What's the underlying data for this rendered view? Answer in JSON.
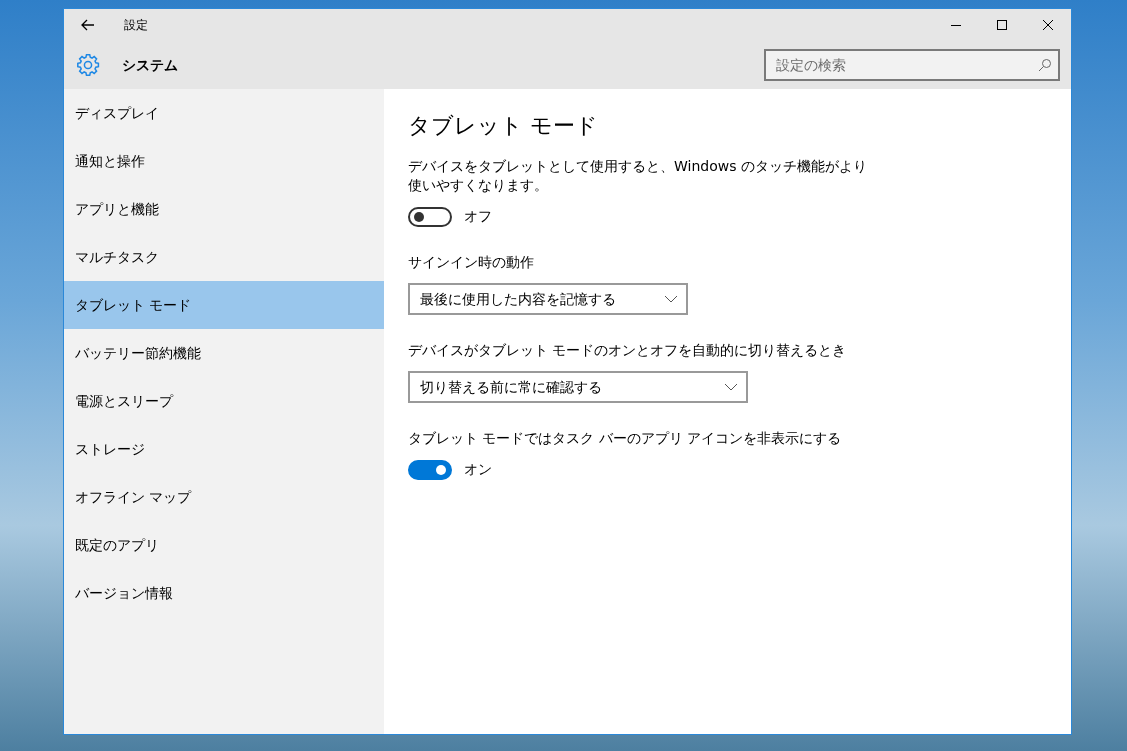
{
  "window": {
    "title": "設定"
  },
  "header": {
    "title": "システム",
    "search": {
      "placeholder": "設定の検索"
    }
  },
  "sidebar": {
    "items": [
      {
        "label": "ディスプレイ",
        "selected": false
      },
      {
        "label": "通知と操作",
        "selected": false
      },
      {
        "label": "アプリと機能",
        "selected": false
      },
      {
        "label": "マルチタスク",
        "selected": false
      },
      {
        "label": "タブレット モード",
        "selected": true
      },
      {
        "label": "バッテリー節約機能",
        "selected": false
      },
      {
        "label": "電源とスリープ",
        "selected": false
      },
      {
        "label": "ストレージ",
        "selected": false
      },
      {
        "label": "オフライン マップ",
        "selected": false
      },
      {
        "label": "既定のアプリ",
        "selected": false
      },
      {
        "label": "バージョン情報",
        "selected": false
      }
    ]
  },
  "content": {
    "title": "タブレット モード",
    "settings": [
      {
        "kind": "toggle",
        "label": "デバイスをタブレットとして使用すると、Windows のタッチ機能がより使いやすくなります。",
        "on": false,
        "state_label": "オフ"
      },
      {
        "kind": "dropdown",
        "label": "サインイン時の動作",
        "value": "最後に使用した内容を記憶する"
      },
      {
        "kind": "dropdown",
        "label": "デバイスがタブレット モードのオンとオフを自動的に切り替えるとき",
        "value": "切り替える前に常に確認する"
      },
      {
        "kind": "toggle",
        "label": "タブレット モードではタスク バーのアプリ アイコンを非表示にする",
        "on": true,
        "state_label": "オン"
      }
    ]
  }
}
